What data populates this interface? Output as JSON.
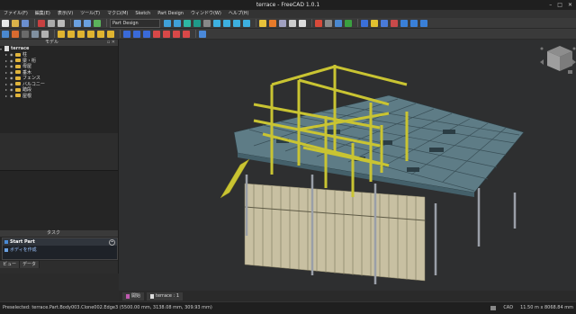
{
  "window": {
    "title": "terrace - FreeCAD 1.0.1"
  },
  "menubar": [
    "ファイル(F)",
    "編集(E)",
    "表示(V)",
    "ツール(T)",
    "マクロ(M)",
    "Sketch",
    "Part Design",
    "ウィンドウ(W)",
    "ヘルプ(H)"
  ],
  "toolbar": {
    "workbench": "Part Design"
  },
  "combo": {
    "model_title": "モデル",
    "tree": {
      "root": "terrace",
      "items": [
        "柱",
        "梁・桁",
        "母屋",
        "垂木",
        "フェンス",
        "バルコニー",
        "踏段",
        "屋根"
      ]
    },
    "tabs": [
      "ビュー",
      "データ"
    ],
    "task_title": "タスク",
    "task_panel": {
      "title": "Start Part",
      "action": "ボディを作成"
    }
  },
  "view_tabs": [
    {
      "label": "開始"
    },
    {
      "label": "terrace : 1"
    }
  ],
  "statusbar": {
    "message": "Preselected: terrace.Part.Body003.Clone002.Edge3 (5500.00 mm, 3138.08 mm, 309.93 mm)",
    "nav_style": "CAD",
    "dimension": "11.50 m x 8068.84 mm"
  },
  "colors": {
    "structure_yellow": "#c9c432",
    "roof_blue": "#5e7c86",
    "fence_cream": "#c8c0a2",
    "post_gray": "#9a9fa8"
  }
}
